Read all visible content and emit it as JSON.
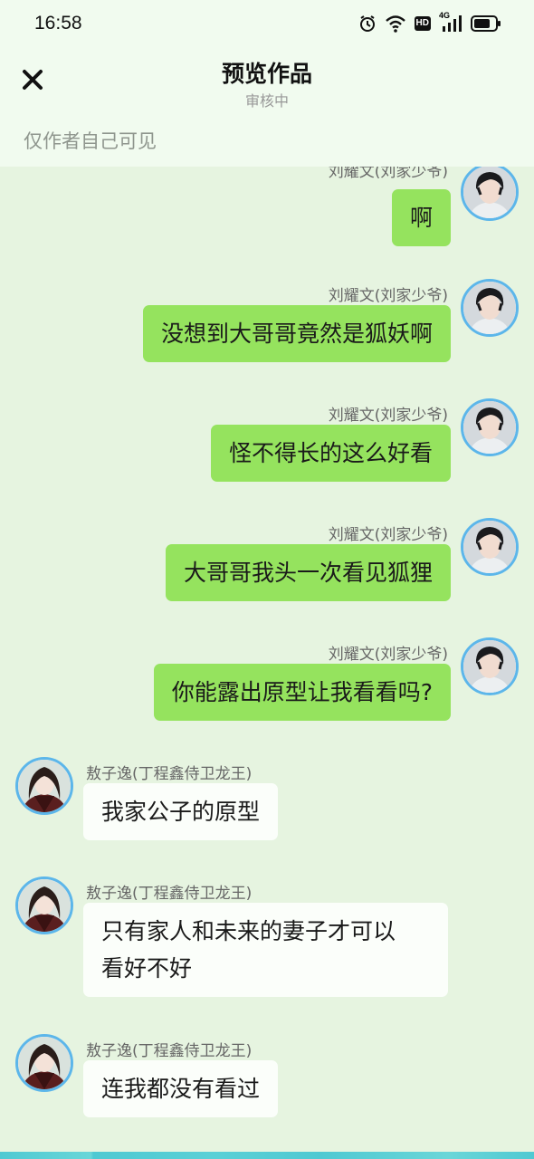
{
  "status_bar": {
    "time": "16:58",
    "icons": [
      "alarm-icon",
      "wifi-icon",
      "hd-icon",
      "signal-4g-icon",
      "battery-icon"
    ],
    "hd_label": "HD",
    "net_label": "4G"
  },
  "header": {
    "title": "预览作品",
    "subtitle": "审核中",
    "close_icon": "close-icon"
  },
  "visibility_note": "仅作者自己可见",
  "colors": {
    "sent_bubble": "#95e35e",
    "received_bubble": "#fbfefa",
    "background": "#e6f4e0",
    "avatar_border": "#5cb6ea"
  },
  "messages": [
    {
      "side": "right",
      "name": "刘耀文(刘家少爷)",
      "text": "啊"
    },
    {
      "side": "right",
      "name": "刘耀文(刘家少爷)",
      "text": "没想到大哥哥竟然是狐妖啊"
    },
    {
      "side": "right",
      "name": "刘耀文(刘家少爷)",
      "text": "怪不得长的这么好看"
    },
    {
      "side": "right",
      "name": "刘耀文(刘家少爷)",
      "text": "大哥哥我头一次看见狐狸"
    },
    {
      "side": "right",
      "name": "刘耀文(刘家少爷)",
      "text": "你能露出原型让我看看吗?"
    },
    {
      "side": "left",
      "name": "敖子逸(丁程鑫侍卫龙王)",
      "text": "我家公子的原型"
    },
    {
      "side": "left",
      "name": "敖子逸(丁程鑫侍卫龙王)",
      "text_line1": "只有家人和未来的妻子才可以",
      "text_line2": "看好不好"
    },
    {
      "side": "left",
      "name": "敖子逸(丁程鑫侍卫龙王)",
      "text": "连我都没有看过"
    }
  ]
}
